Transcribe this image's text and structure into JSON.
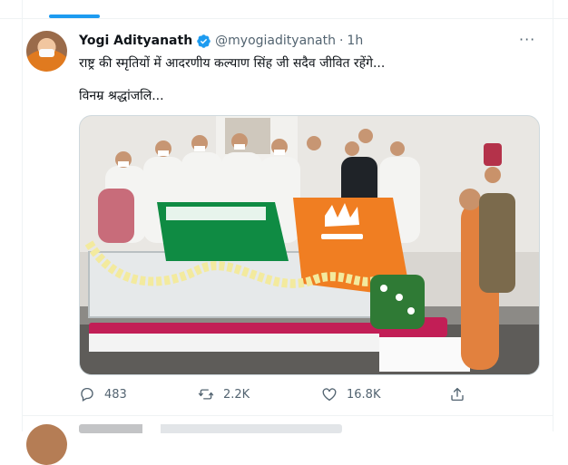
{
  "tweet": {
    "author_name": "Yogi Adityanath",
    "handle": "@myogiadityanath",
    "separator": "·",
    "time": "1h",
    "more_label": "···",
    "text_line1": "राष्ट्र की स्मृतियों में आदरणीय कल्याण सिंह जी सदैव जीवित रहेंगे...",
    "text_line2": "विनम्र श्रद्धांजलि...",
    "stats": {
      "replies": "483",
      "retweets": "2.2K",
      "likes": "16.8K"
    }
  },
  "colors": {
    "accent": "#1d9bf0",
    "text": "#0f1419",
    "secondary": "#536471",
    "border": "#eff3f4"
  },
  "icons": {
    "verified": "verified-badge-icon",
    "more": "more-horizontal-icon",
    "reply": "reply-icon",
    "retweet": "retweet-icon",
    "like": "like-icon",
    "share": "share-icon"
  }
}
